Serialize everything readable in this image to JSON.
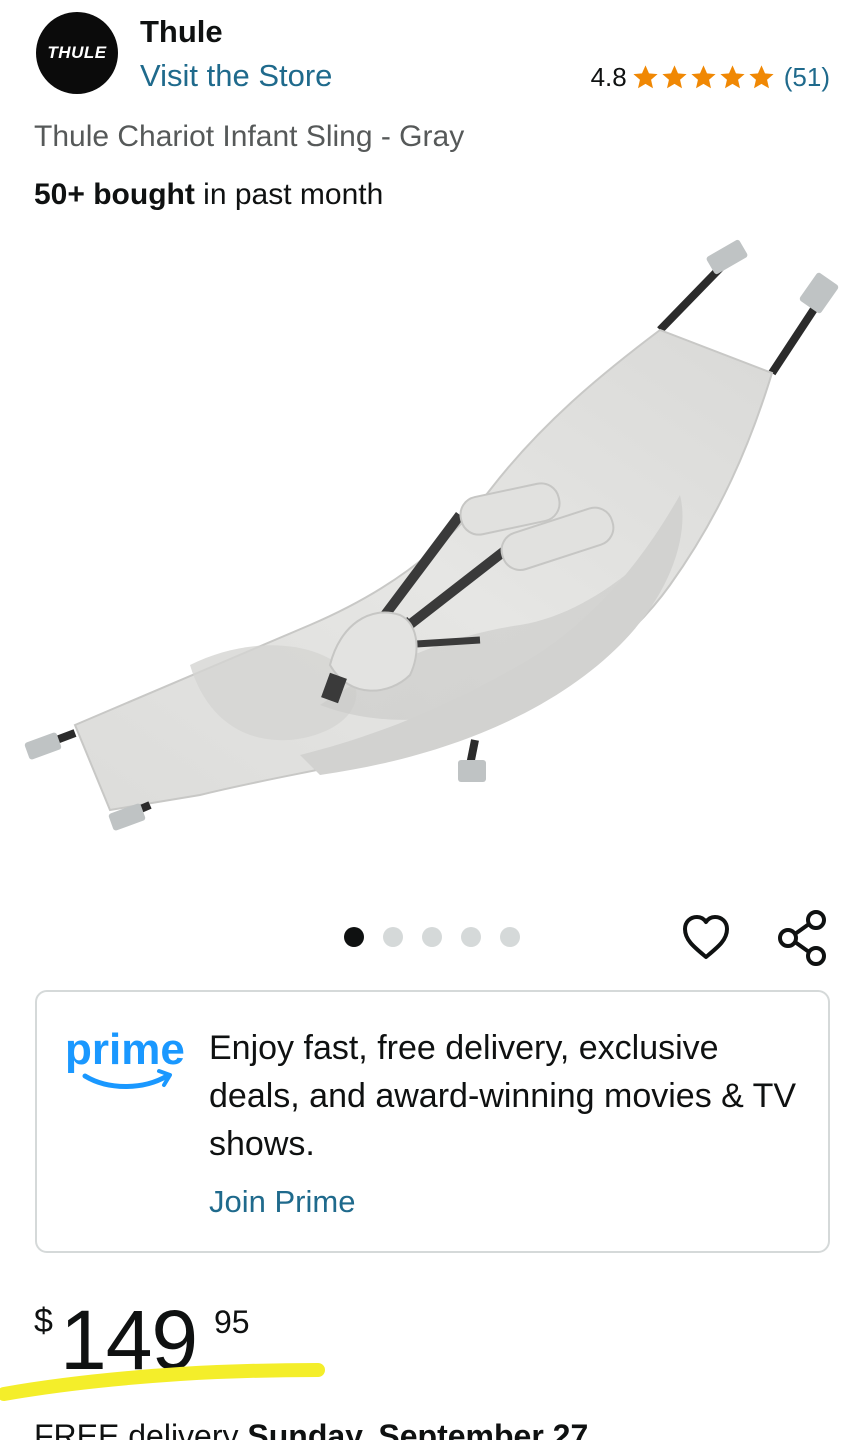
{
  "brand": {
    "logo_text": "THULE",
    "name": "Thule",
    "visit_store": "Visit the Store"
  },
  "rating": {
    "value": "4.8",
    "stars": 5,
    "count": "(51)",
    "star_color": "#f08804"
  },
  "product": {
    "title": "Thule Chariot Infant Sling - Gray",
    "bought_bold": "50+ bought",
    "bought_rest": " in past month"
  },
  "gallery": {
    "total_images": 5,
    "active_index": 0
  },
  "prime": {
    "logo_text": "prime",
    "description": "Enjoy fast, free delivery, exclusive deals, and award-winning movies & TV shows.",
    "cta": "Join Prime",
    "brand_color": "#1a98ff"
  },
  "price": {
    "currency": "$",
    "whole": "149",
    "fraction": "95"
  },
  "delivery": {
    "prefix": "FREE delivery ",
    "date": "Sunday, September 27"
  },
  "colors": {
    "link": "#1f6a8c",
    "highlight": "#f4ee2a"
  }
}
